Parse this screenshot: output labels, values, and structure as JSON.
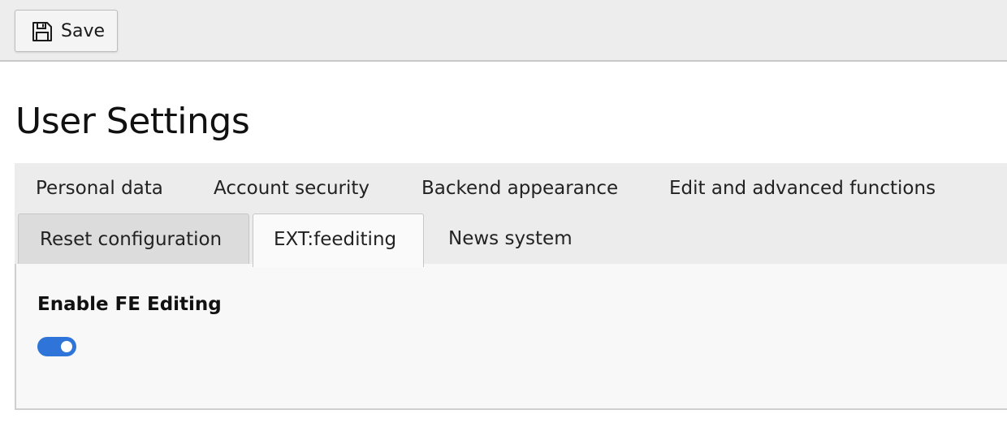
{
  "toolbar": {
    "save_label": "Save"
  },
  "page": {
    "title": "User Settings"
  },
  "tabs": {
    "row1": [
      {
        "label": "Personal data"
      },
      {
        "label": "Account security"
      },
      {
        "label": "Backend appearance"
      },
      {
        "label": "Edit and advanced functions"
      }
    ],
    "row2": [
      {
        "label": "Reset configuration"
      },
      {
        "label": "EXT:feediting",
        "active": true
      },
      {
        "label": "News system"
      }
    ]
  },
  "panel": {
    "field_label": "Enable FE Editing",
    "toggle_on": true
  },
  "colors": {
    "toggle_accent": "#2f74d8",
    "toolbar_bg": "#ededed",
    "panel_bg": "#f8f8f8"
  },
  "icons": {
    "save": "floppy-disk-icon"
  }
}
